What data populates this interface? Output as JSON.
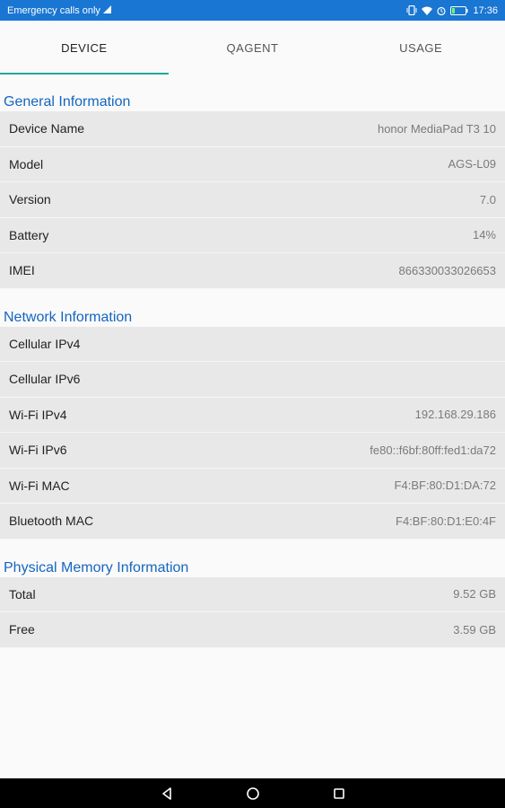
{
  "status_bar": {
    "carrier_text": "Emergency calls only",
    "time": "17:36"
  },
  "tabs": [
    {
      "label": "DEVICE",
      "active": true
    },
    {
      "label": "QAGENT",
      "active": false
    },
    {
      "label": "USAGE",
      "active": false
    }
  ],
  "sections": {
    "general": {
      "title": "General Information",
      "rows": [
        {
          "label": "Device Name",
          "value": "honor MediaPad T3 10"
        },
        {
          "label": "Model",
          "value": "AGS-L09"
        },
        {
          "label": "Version",
          "value": "7.0"
        },
        {
          "label": "Battery",
          "value": "14%"
        },
        {
          "label": "IMEI",
          "value": "866330033026653"
        }
      ]
    },
    "network": {
      "title": "Network Information",
      "rows": [
        {
          "label": "Cellular IPv4",
          "value": ""
        },
        {
          "label": "Cellular IPv6",
          "value": ""
        },
        {
          "label": "Wi-Fi IPv4",
          "value": "192.168.29.186"
        },
        {
          "label": "Wi-Fi IPv6",
          "value": "fe80::f6bf:80ff:fed1:da72"
        },
        {
          "label": "Wi-Fi MAC",
          "value": "F4:BF:80:D1:DA:72"
        },
        {
          "label": "Bluetooth MAC",
          "value": "F4:BF:80:D1:E0:4F"
        }
      ]
    },
    "memory": {
      "title": "Physical Memory Information",
      "rows": [
        {
          "label": "Total",
          "value": "9.52 GB"
        },
        {
          "label": "Free",
          "value": "3.59 GB"
        }
      ]
    }
  },
  "nav_bar": {
    "icons": [
      "back-icon",
      "home-icon",
      "recents-icon"
    ]
  },
  "colors": {
    "status_bar": "#1976d2",
    "accent_underline": "#26a69a",
    "section_title": "#1565c0",
    "row_background": "#e8e8e8"
  }
}
